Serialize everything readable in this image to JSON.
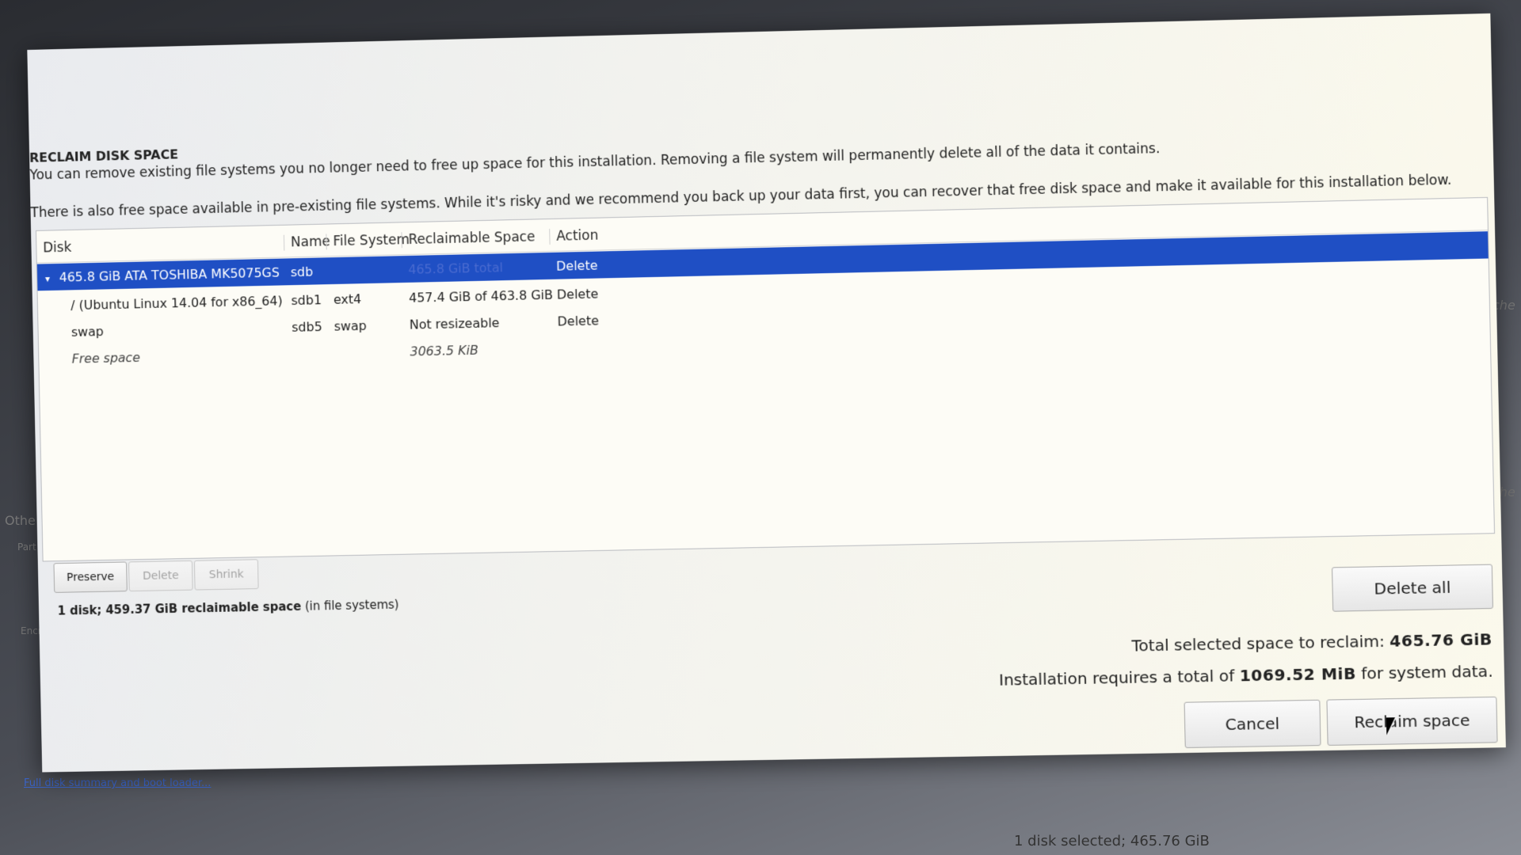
{
  "dialog": {
    "title": "RECLAIM DISK SPACE",
    "description_1": "You can remove existing file systems you no longer need to free up space for this installation.  Removing a file system will permanently delete all of the data it contains.",
    "description_2": "There is also free space available in pre-existing file systems.  While it's risky and we recommend you back up your data first, you can recover that free disk space and make it available for this installation below."
  },
  "table": {
    "columns": {
      "disk": "Disk",
      "name": "Name",
      "filesystem": "File System",
      "reclaimable": "Reclaimable Space",
      "action": "Action"
    },
    "rows": [
      {
        "disk": "465.8 GiB ATA TOSHIBA MK5075GS",
        "name": "sdb",
        "filesystem": "",
        "reclaimable": "465.8 GiB total",
        "action": "Delete",
        "expander": "▾"
      },
      {
        "disk": "/ (Ubuntu Linux 14.04 for x86_64)",
        "name": "sdb1",
        "filesystem": "ext4",
        "reclaimable": "457.4 GiB of 463.8 GiB",
        "action": "Delete"
      },
      {
        "disk": "swap",
        "name": "sdb5",
        "filesystem": "swap",
        "reclaimable": "Not resizeable",
        "action": "Delete"
      },
      {
        "disk": "Free space",
        "name": "",
        "filesystem": "",
        "reclaimable": "3063.5 KiB",
        "action": ""
      }
    ]
  },
  "toolbar": {
    "preserve_label": "Preserve",
    "delete_label": "Delete",
    "shrink_label": "Shrink"
  },
  "summary": {
    "prefix": "1 disk; ",
    "amount": "459.37 GiB",
    "middle": " reclaimable space",
    "suffix": " (in file systems)"
  },
  "delete_all_label": "Delete all",
  "totals": {
    "selected_prefix": "Total selected space to reclaim: ",
    "selected_value": "465.76 GiB",
    "requires_prefix": "Installation requires a total of ",
    "requires_value": "1069.52 MiB",
    "requires_suffix": " for system data."
  },
  "buttons": {
    "cancel_label": "Cancel",
    "reclaim_label": "Reclaim space"
  },
  "background": {
    "link_text": "Full disk summary and boot loader...",
    "status_text": "1 disk selected; 465.76 GiB",
    "side_1": "Othe",
    "side_2": "Part",
    "side_3": "Encr",
    "side_right_1": "che",
    "side_right_2": "che"
  }
}
